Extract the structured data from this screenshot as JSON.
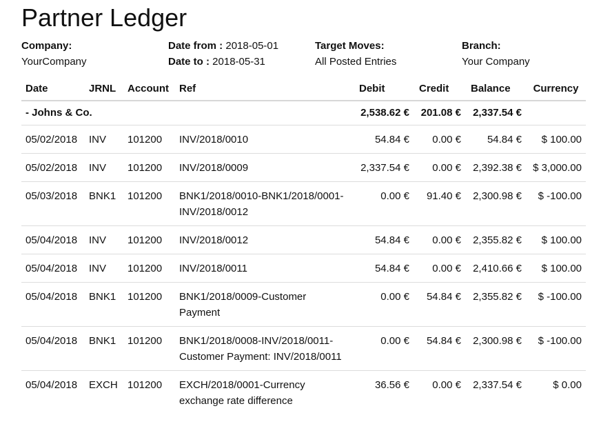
{
  "report": {
    "title": "Partner Ledger",
    "company_label": "Company:",
    "company_value": "YourCompany",
    "date_from_label": "Date from :",
    "date_from_value": "2018-05-01",
    "date_to_label": "Date to :",
    "date_to_value": "2018-05-31",
    "target_label": "Target Moves:",
    "target_value": "All Posted Entries",
    "branch_label": "Branch:",
    "branch_value": "Your Company"
  },
  "table": {
    "headers": {
      "date": "Date",
      "jrnl": "JRNL",
      "account": "Account",
      "ref": "Ref",
      "debit": "Debit",
      "credit": "Credit",
      "balance": "Balance",
      "currency": "Currency"
    },
    "partner": {
      "name": "- Johns & Co.",
      "debit": "2,538.62 €",
      "credit": "201.08 €",
      "balance": "2,337.54 €"
    },
    "rows": [
      {
        "date": "05/02/2018",
        "jrnl": "INV",
        "account": "101200",
        "ref": "INV/2018/0010",
        "debit": "54.84 €",
        "credit": "0.00 €",
        "balance": "54.84 €",
        "currency": "$ 100.00"
      },
      {
        "date": "05/02/2018",
        "jrnl": "INV",
        "account": "101200",
        "ref": "INV/2018/0009",
        "debit": "2,337.54 €",
        "credit": "0.00 €",
        "balance": "2,392.38 €",
        "currency": "$ 3,000.00"
      },
      {
        "date": "05/03/2018",
        "jrnl": "BNK1",
        "account": "101200",
        "ref": "BNK1/2018/0010-BNK1/2018/0001-INV/2018/0012",
        "debit": "0.00 €",
        "credit": "91.40 €",
        "balance": "2,300.98 €",
        "currency": "$ -100.00"
      },
      {
        "date": "05/04/2018",
        "jrnl": "INV",
        "account": "101200",
        "ref": "INV/2018/0012",
        "debit": "54.84 €",
        "credit": "0.00 €",
        "balance": "2,355.82 €",
        "currency": "$ 100.00"
      },
      {
        "date": "05/04/2018",
        "jrnl": "INV",
        "account": "101200",
        "ref": "INV/2018/0011",
        "debit": "54.84 €",
        "credit": "0.00 €",
        "balance": "2,410.66 €",
        "currency": "$ 100.00"
      },
      {
        "date": "05/04/2018",
        "jrnl": "BNK1",
        "account": "101200",
        "ref": "BNK1/2018/0009-Customer Payment",
        "debit": "0.00 €",
        "credit": "54.84 €",
        "balance": "2,355.82 €",
        "currency": "$ -100.00"
      },
      {
        "date": "05/04/2018",
        "jrnl": "BNK1",
        "account": "101200",
        "ref": "BNK1/2018/0008-INV/2018/0011-Customer Payment: INV/2018/0011",
        "debit": "0.00 €",
        "credit": "54.84 €",
        "balance": "2,300.98 €",
        "currency": "$ -100.00"
      },
      {
        "date": "05/04/2018",
        "jrnl": "EXCH",
        "account": "101200",
        "ref": "EXCH/2018/0001-Currency exchange rate difference",
        "debit": "36.56 €",
        "credit": "0.00 €",
        "balance": "2,337.54 €",
        "currency": "$ 0.00"
      }
    ]
  }
}
